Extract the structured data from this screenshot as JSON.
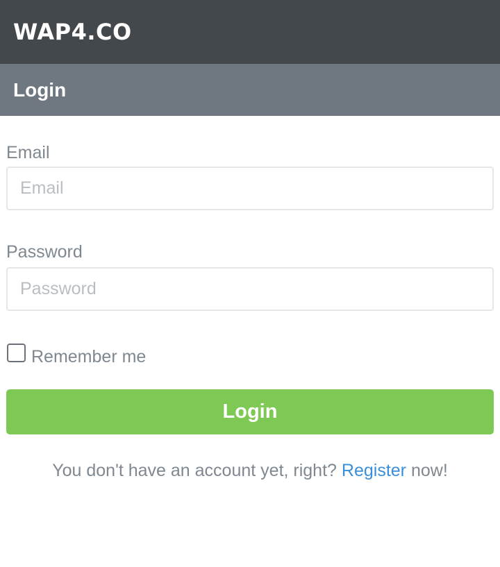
{
  "header": {
    "logo_text": "WAP4.CO"
  },
  "title_bar": {
    "title": "Login"
  },
  "form": {
    "email": {
      "label": "Email",
      "placeholder": "Email",
      "value": ""
    },
    "password": {
      "label": "Password",
      "placeholder": "Password",
      "value": ""
    },
    "remember": {
      "label": "Remember me",
      "checked": false
    },
    "submit_label": "Login"
  },
  "footer": {
    "prefix": "You don't have an account yet, right?",
    "link_text": "Register",
    "suffix": "now!"
  },
  "colors": {
    "header_bg": "#43484d",
    "title_bg": "#6f7780",
    "button_bg": "#7ec854",
    "link": "#3a8fd8",
    "label_text": "#7f8891"
  }
}
